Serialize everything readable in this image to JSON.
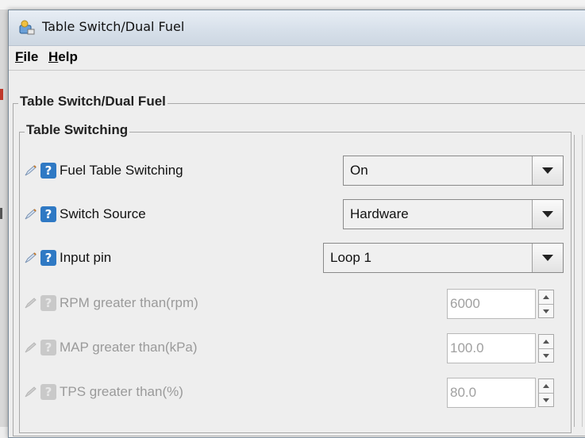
{
  "window": {
    "title": "Table Switch/Dual Fuel"
  },
  "menu": {
    "file": "File",
    "file_mnemonic": "F",
    "file_rest": "ile",
    "help": "Help",
    "help_mnemonic": "H",
    "help_rest": "elp"
  },
  "outer_group": {
    "title": "Table Switch/Dual Fuel"
  },
  "inner_group": {
    "title": "Table Switching"
  },
  "fields": {
    "fuel_table_switching": {
      "label": "Fuel Table Switching",
      "value": "On"
    },
    "switch_source": {
      "label": "Switch Source",
      "value": "Hardware"
    },
    "input_pin": {
      "label": "Input pin",
      "value": "Loop 1"
    },
    "rpm": {
      "label": "RPM greater than(rpm)",
      "value": "6000"
    },
    "map": {
      "label": "MAP greater than(kPa)",
      "value": "100.0"
    },
    "tps": {
      "label": "TPS greater than(%)",
      "value": "80.0"
    }
  },
  "icons": {
    "help_glyph": "?",
    "edit": "edit-icon",
    "help": "help-icon"
  },
  "colors": {
    "help_blue": "#2f79c4",
    "disabled_text": "#9a9a9a"
  }
}
